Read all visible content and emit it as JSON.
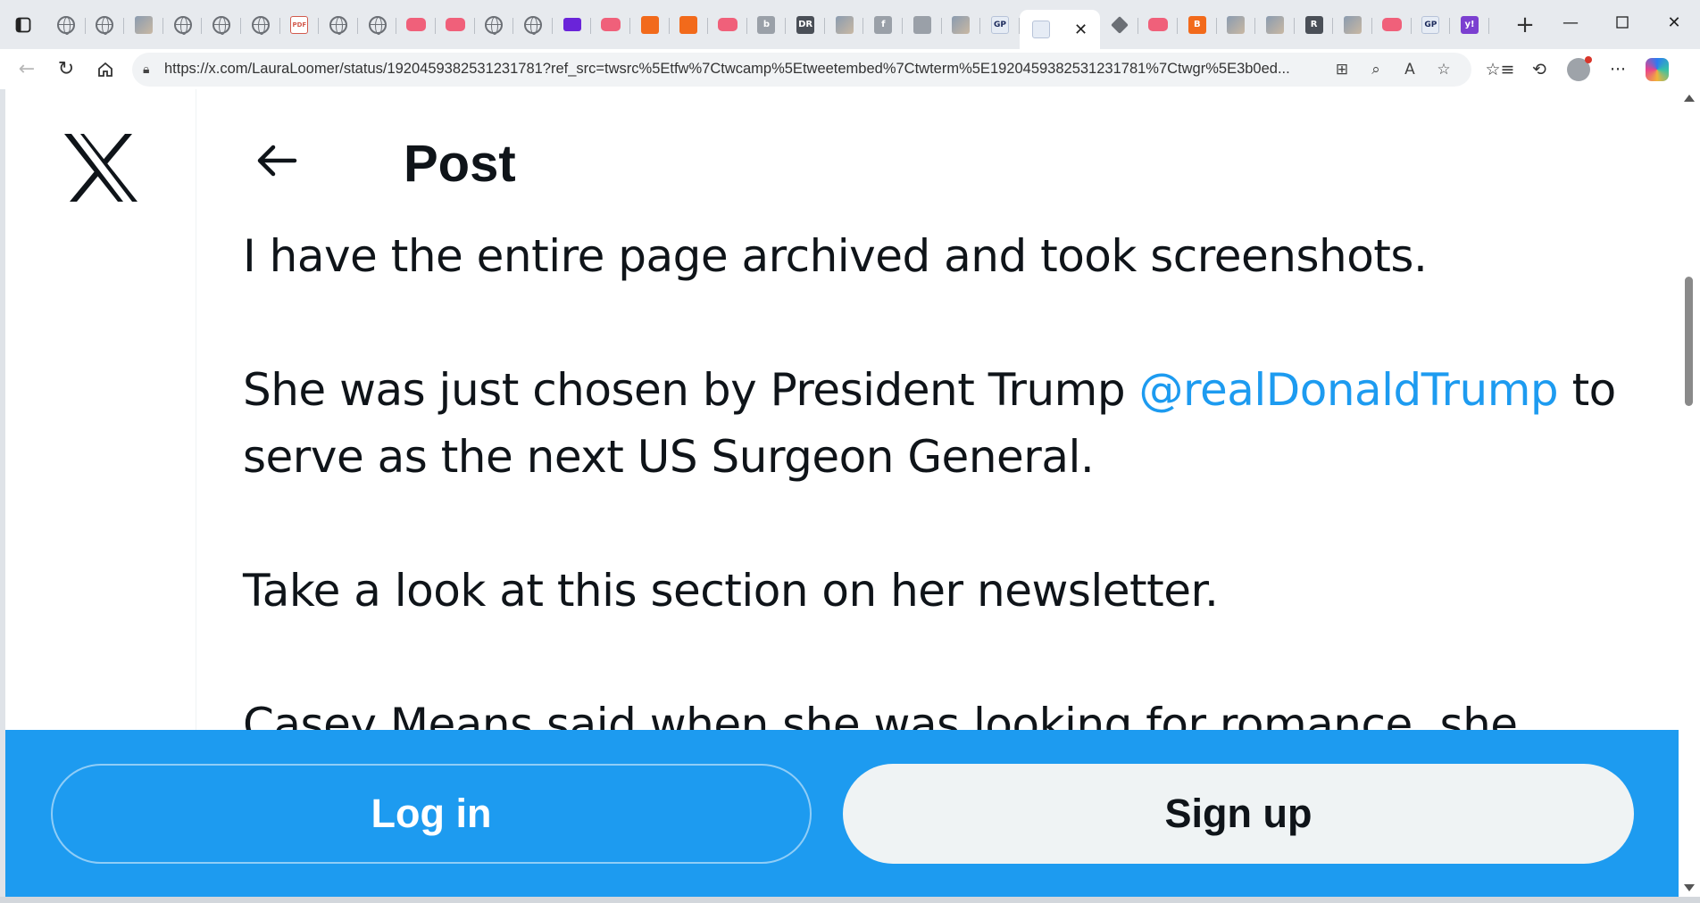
{
  "browser": {
    "tabs": [
      {
        "icon": "globe-icon"
      },
      {
        "icon": "globe-icon"
      },
      {
        "icon": "news-favicon"
      },
      {
        "icon": "globe-icon"
      },
      {
        "icon": "globe-icon"
      },
      {
        "icon": "globe-icon"
      },
      {
        "icon": "pdf-favicon",
        "label": "PDF"
      },
      {
        "icon": "globe-icon"
      },
      {
        "icon": "globe-icon"
      },
      {
        "icon": "youtube-favicon"
      },
      {
        "icon": "youtube-favicon"
      },
      {
        "icon": "globe-icon"
      },
      {
        "icon": "globe-icon"
      },
      {
        "icon": "mail-favicon"
      },
      {
        "icon": "youtube-favicon"
      },
      {
        "icon": "bookmark-favicon"
      },
      {
        "icon": "bookmark-favicon"
      },
      {
        "icon": "youtube-favicon"
      },
      {
        "icon": "bing-favicon",
        "label": "b"
      },
      {
        "icon": "site-favicon",
        "label": "DR"
      },
      {
        "icon": "image-favicon"
      },
      {
        "icon": "facebook-favicon",
        "label": "f"
      },
      {
        "icon": "seal-favicon"
      },
      {
        "icon": "image-favicon"
      },
      {
        "icon": "gp-favicon",
        "label": "GP"
      }
    ],
    "active_tab": {
      "icon": "x-favicon"
    },
    "tabs_after": [
      {
        "icon": "diamond-favicon"
      },
      {
        "icon": "youtube-favicon"
      },
      {
        "icon": "blogger-favicon",
        "label": "B"
      },
      {
        "icon": "image-favicon"
      },
      {
        "icon": "image-favicon"
      },
      {
        "icon": "site-favicon",
        "label": "R"
      },
      {
        "icon": "image-favicon"
      },
      {
        "icon": "youtube-favicon"
      },
      {
        "icon": "gp-favicon",
        "label": "GP"
      },
      {
        "icon": "yahoo-favicon",
        "label": "y!"
      }
    ],
    "url": "https://x.com/LauraLoomer/status/1920459382531231781?ref_src=twsrc%5Etfw%7Ctwcamp%5Etweetembed%7Ctwterm%5E1920459382531231781%7Ctwgr%5E3b0ed..."
  },
  "page": {
    "header_title": "Post",
    "paragraphs": [
      {
        "text": "I have the entire page archived and took screenshots."
      },
      {
        "line1_before": "She was just chosen by President Trump ",
        "mention": "@realDonaldTrump",
        "line1_after": " to",
        "line2": "serve as the next US Surgeon General."
      },
      {
        "text": "Take a look at this section on her newsletter."
      },
      {
        "text": "Casey Means said when she was looking for romance, she"
      }
    ]
  },
  "login_bar": {
    "login_label": "Log in",
    "signup_label": "Sign up"
  },
  "colors": {
    "brand_blue": "#1d9bf0",
    "text": "#0f1419",
    "signup_bg": "#eff3f4"
  }
}
